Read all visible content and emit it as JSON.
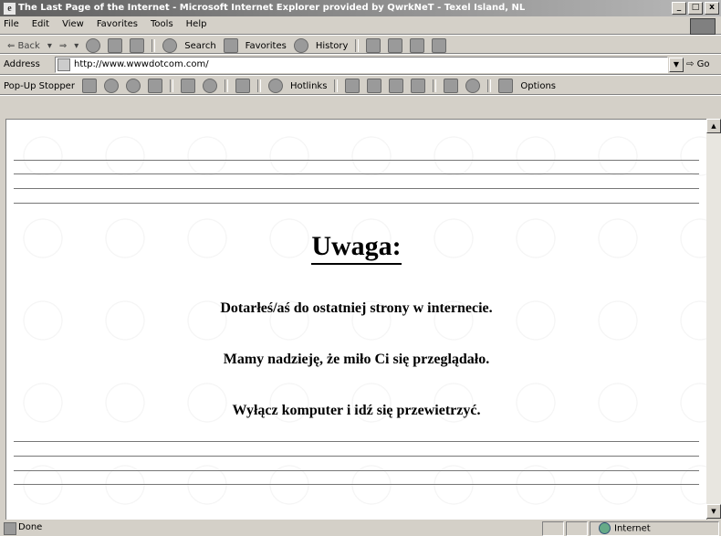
{
  "window": {
    "title": "The Last Page of the Internet - Microsoft Internet Explorer provided by QwrkNeT - Texel Island, NL",
    "minimize": "_",
    "maximize": "□",
    "close": "x"
  },
  "menu": [
    "File",
    "Edit",
    "View",
    "Favorites",
    "Tools",
    "Help"
  ],
  "nav": {
    "back": "⇐ Back",
    "search": "Search",
    "favorites": "Favorites",
    "history": "History"
  },
  "address": {
    "label": "Address",
    "url": "http://www.wwwdotcom.com/",
    "go": "Go"
  },
  "links": {
    "popup_stopper": "Pop-Up Stopper",
    "hotlinks": "Hotlinks",
    "options": "Options"
  },
  "page": {
    "heading": "Uwaga:",
    "line1": "Dotarłeś/aś do ostatniej strony w internecie.",
    "line2": "Mamy nadzieję, że miło Ci się przeglądało.",
    "line3": "Wyłącz komputer i idź się przewietrzyć."
  },
  "status": {
    "text": "Done",
    "zone": "Internet"
  }
}
